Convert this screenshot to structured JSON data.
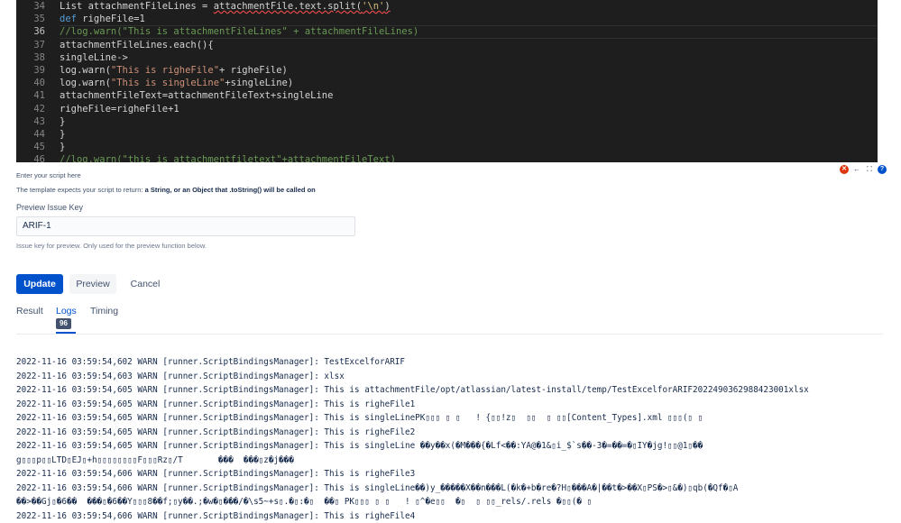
{
  "editor": {
    "line_numbers": [
      "34",
      "35",
      "36",
      "37",
      "38",
      "39",
      "40",
      "41",
      "42",
      "43",
      "44",
      "45",
      "46"
    ],
    "active_line": "36",
    "lines": {
      "l34_a": "List attachmentFileLines = ",
      "l34_b": "attachmentFile.text.split(",
      "l34_c": "'\\n'",
      "l34_d": ")",
      "l35_a": "def",
      "l35_b": " righeFile=1",
      "l36": "//log.warn(\"This is attachmentFileLines\" + attachmentFileLines)",
      "l37": "attachmentFileLines.each(){",
      "l38": "singleLine->",
      "l39_a": "log.warn(",
      "l39_b": "\"This is righeFile\"",
      "l39_c": "+ righeFile)",
      "l40_a": "log.warn(",
      "l40_b": "\"This is singleLine\"",
      "l40_c": "+singleLine)",
      "l41": "attachmentFileText=attachmentFileText+singleLine",
      "l42": "righeFile=righeFile+1",
      "l43": "}",
      "l44": "}",
      "l45": "}",
      "l46": "//log.warn(\"this is attachmentfiletext\"+attachmentFileText)"
    }
  },
  "script_hint": "Enter your script here",
  "template_hint": {
    "prefix": "The template expects your script to return: ",
    "bold": "a String, or an Object that .toString() will be called on"
  },
  "editor_icons": [
    "error-icon",
    "arrow-left-icon",
    "fullscreen-icon",
    "help-icon"
  ],
  "preview_issue": {
    "label": "Preview Issue Key",
    "value": "ARIF-1",
    "hint": "Issue key for preview. Only used for the preview function below."
  },
  "buttons": {
    "update": "Update",
    "preview": "Preview",
    "cancel": "Cancel"
  },
  "tabs": {
    "result": "Result",
    "logs": "Logs",
    "logs_count": "96",
    "timing": "Timing",
    "active": "Logs"
  },
  "logs": [
    "2022-11-16 03:59:54,602 WARN [runner.ScriptBindingsManager]: TestExcelforARIF",
    "2022-11-16 03:59:54,603 WARN [runner.ScriptBindingsManager]: xlsx",
    "2022-11-16 03:59:54,605 WARN [runner.ScriptBindingsManager]: This is attachmentFile/opt/atlassian/latest-install/temp/TestExcelforARIF2022490362988423001xlsx",
    "2022-11-16 03:59:54,605 WARN [runner.ScriptBindingsManager]: This is righeFile1",
    "2022-11-16 03:59:54,605 WARN [runner.ScriptBindingsManager]: This is singleLinePK▯▯▯ ▯ ▯   ! {▯▯!z▯  ▯▯  ▯ ▯▯[Content_Types].xml ▯▯▯(▯ ▯",
    "2022-11-16 03:59:54,605 WARN [runner.ScriptBindingsManager]: This is righeFile2",
    "2022-11-16 03:59:54,605 WARN [runner.ScriptBindingsManager]: This is singleLine ��y��x(�M���{�Lf<��:YA@�1&▯i_$`s��-3�=��=�▯IY�jg!▯▯@1▯��",
    "g▯▯▯p▯▯LTD▯EJ▯+h▯▯▯▯▯▯▯▯F▯▯▯Rz▯/T       ���  ���▯z�j���",
    "2022-11-16 03:59:54,606 WARN [runner.ScriptBindingsManager]: This is righeFile3",
    "2022-11-16 03:59:54,606 WARN [runner.ScriptBindingsManager]: This is singleLine��)y_�����X��n���L(�k�+b�re�?H▯���A�|��t�>��X▯PS�>▯&�)▯qb(�Qf�▯A",
    "��>��Gj▯�6��  ���▯�6��Y▯▯▯8��f;▯y��.;�w�▯���/�\\s5~+s▯.�▯:�▯  ��▯ PK▯▯▯ ▯ ▯   ! ▯^�e▯▯  �▯  ▯ ▯▯_rels/.rels �▯▯(� ▯",
    "2022-11-16 03:59:54,606 WARN [runner.ScriptBindingsManager]: This is righeFile4"
  ]
}
